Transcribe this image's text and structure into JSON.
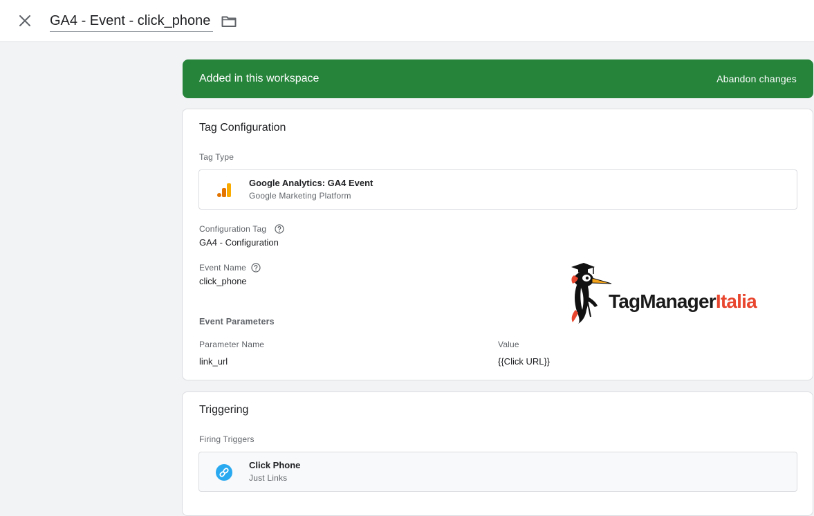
{
  "header": {
    "title": "GA4 - Event - click_phone",
    "close_icon": "close-icon",
    "folder_icon": "folder-icon"
  },
  "banner": {
    "text": "Added in this workspace",
    "action": "Abandon changes",
    "color": "#25833a"
  },
  "tag_configuration": {
    "title": "Tag Configuration",
    "tag_type_label": "Tag Type",
    "tag_type": {
      "name": "Google Analytics: GA4 Event",
      "subtitle": "Google Marketing Platform",
      "icon": "google-analytics-icon"
    },
    "configuration_tag_label": "Configuration Tag",
    "configuration_tag_value": "GA4 - Configuration",
    "event_name_label": "Event Name",
    "event_name_value": "click_phone",
    "event_parameters_label": "Event Parameters",
    "parameters": {
      "name_header": "Parameter Name",
      "value_header": "Value",
      "rows": [
        {
          "name": "link_url",
          "value": "{{Click URL}}"
        }
      ]
    }
  },
  "watermark": {
    "part1": "TagManager",
    "part2": "Italia",
    "icon": "woodpecker-mascot-icon"
  },
  "triggering": {
    "title": "Triggering",
    "firing_triggers_label": "Firing Triggers",
    "trigger": {
      "name": "Click Phone",
      "subtitle": "Just Links",
      "icon": "link-icon"
    }
  }
}
